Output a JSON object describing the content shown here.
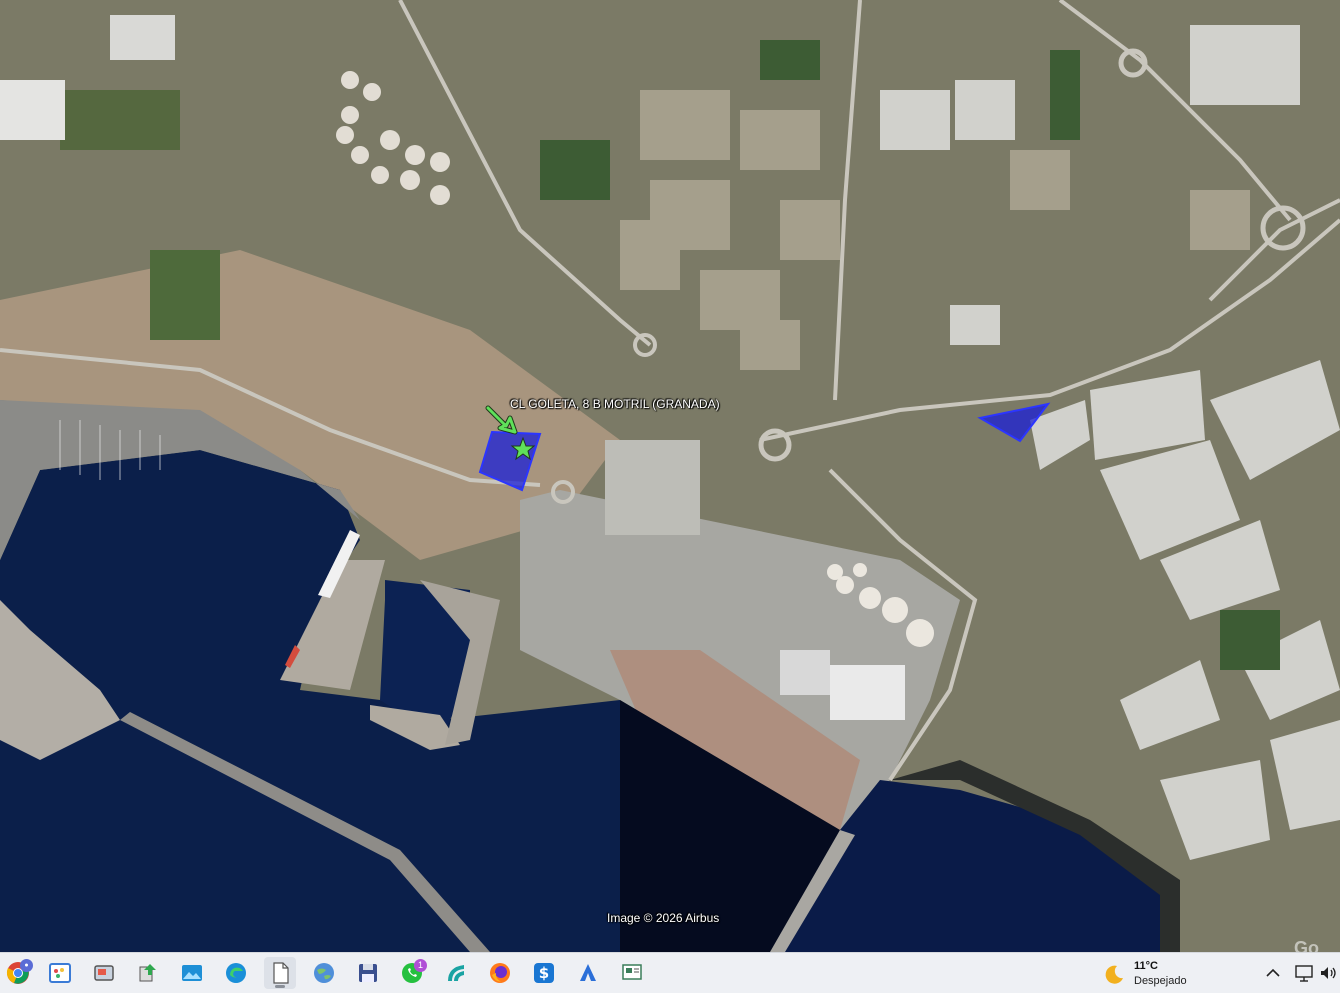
{
  "map": {
    "place_label": "CL GOLETA, 8 B MOTRIL (GRANADA)",
    "attribution": "Image © 2026 Airbus",
    "corner_logo": "Go",
    "colors": {
      "sea": "#0b1f4a",
      "land": "#7b7a66",
      "greenhouse": "#d6d6d2",
      "parcel_fill": "#1a1fd8",
      "parcel_stroke": "#2b35ff",
      "arrow": "#5fe05a"
    }
  },
  "taskbar": {
    "apps": [
      {
        "name": "chrome-icon"
      },
      {
        "name": "paint-icon"
      },
      {
        "name": "snipping-tool-icon"
      },
      {
        "name": "file-transfer-icon"
      },
      {
        "name": "photos-icon"
      },
      {
        "name": "edge-icon"
      },
      {
        "name": "document-icon",
        "active": true
      },
      {
        "name": "google-earth-icon"
      },
      {
        "name": "save-disk-icon"
      },
      {
        "name": "whatsapp-icon",
        "badge": "1"
      },
      {
        "name": "app-wave-icon"
      },
      {
        "name": "firefox-icon"
      },
      {
        "name": "dollar-app-icon"
      },
      {
        "name": "arrow-app-icon"
      },
      {
        "name": "presentation-icon"
      }
    ],
    "weather": {
      "temperature": "11°C",
      "condition": "Despejado",
      "icon": "moon-icon"
    },
    "tray": [
      "chevron-up-icon",
      "network-icon",
      "volume-icon"
    ]
  }
}
